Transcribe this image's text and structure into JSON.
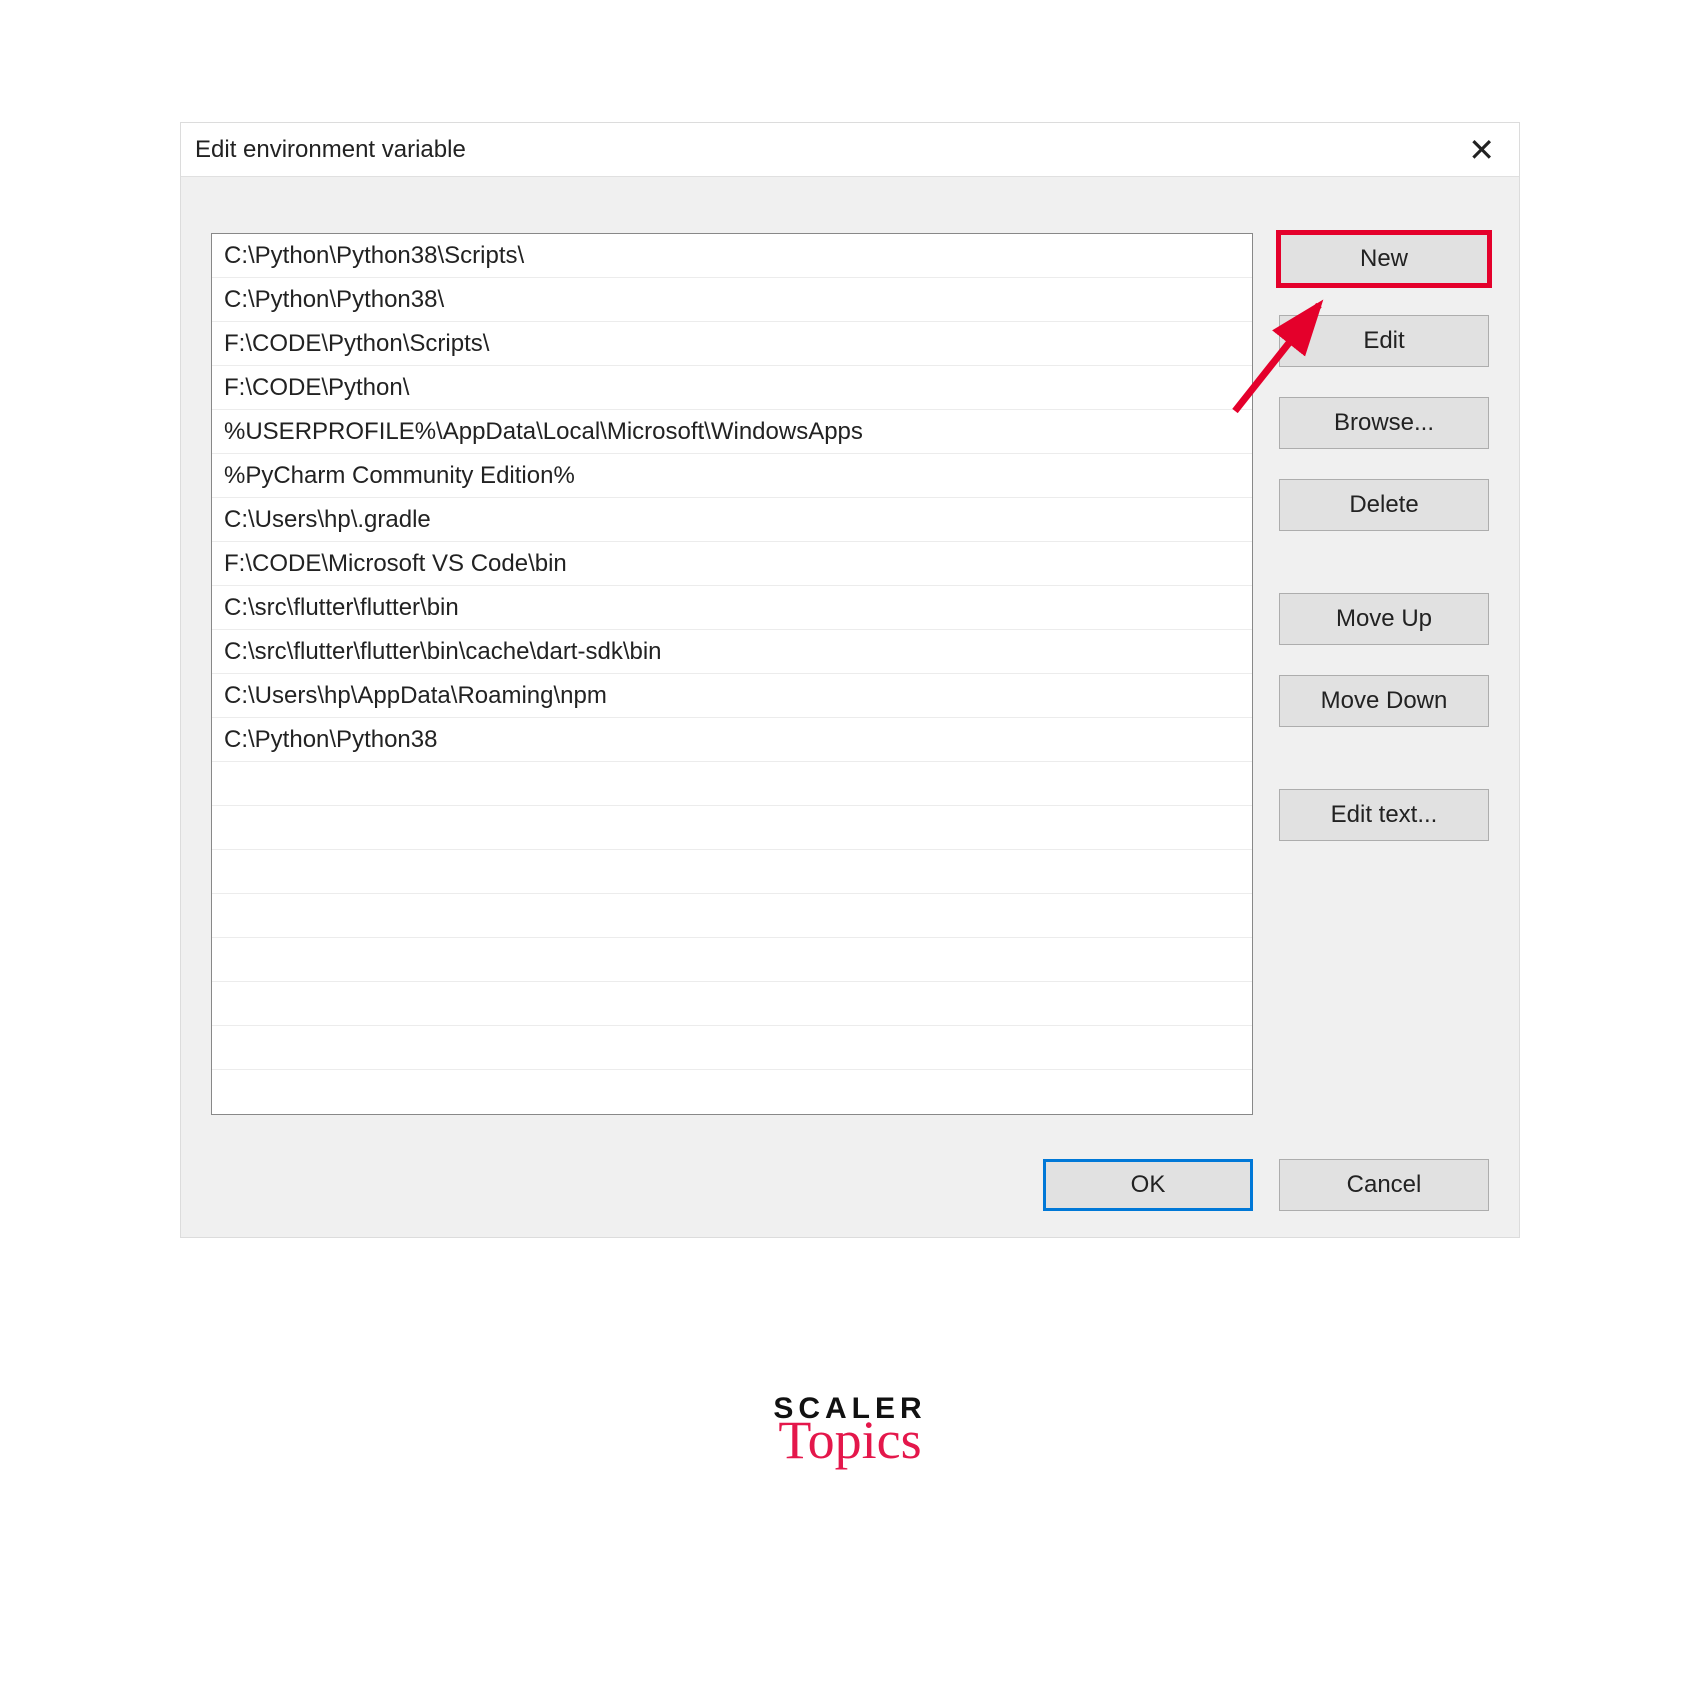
{
  "dialog": {
    "title": "Edit environment variable",
    "paths": [
      "C:\\Python\\Python38\\Scripts\\",
      "C:\\Python\\Python38\\",
      "F:\\CODE\\Python\\Scripts\\",
      "F:\\CODE\\Python\\",
      "%USERPROFILE%\\AppData\\Local\\Microsoft\\WindowsApps",
      "%PyCharm Community Edition%",
      "C:\\Users\\hp\\.gradle",
      "F:\\CODE\\Microsoft VS Code\\bin",
      "C:\\src\\flutter\\flutter\\bin",
      "C:\\src\\flutter\\flutter\\bin\\cache\\dart-sdk\\bin",
      "C:\\Users\\hp\\AppData\\Roaming\\npm",
      "C:\\Python\\Python38"
    ],
    "buttons": {
      "new": "New",
      "edit": "Edit",
      "browse": "Browse...",
      "delete": "Delete",
      "move_up": "Move Up",
      "move_down": "Move Down",
      "edit_text": "Edit text...",
      "ok": "OK",
      "cancel": "Cancel"
    }
  },
  "branding": {
    "line1": "SCALER",
    "line2": "Topics"
  },
  "colors": {
    "highlight_red": "#e4002b",
    "ok_border_blue": "#0078d7",
    "brand_pink": "#e4174b"
  }
}
